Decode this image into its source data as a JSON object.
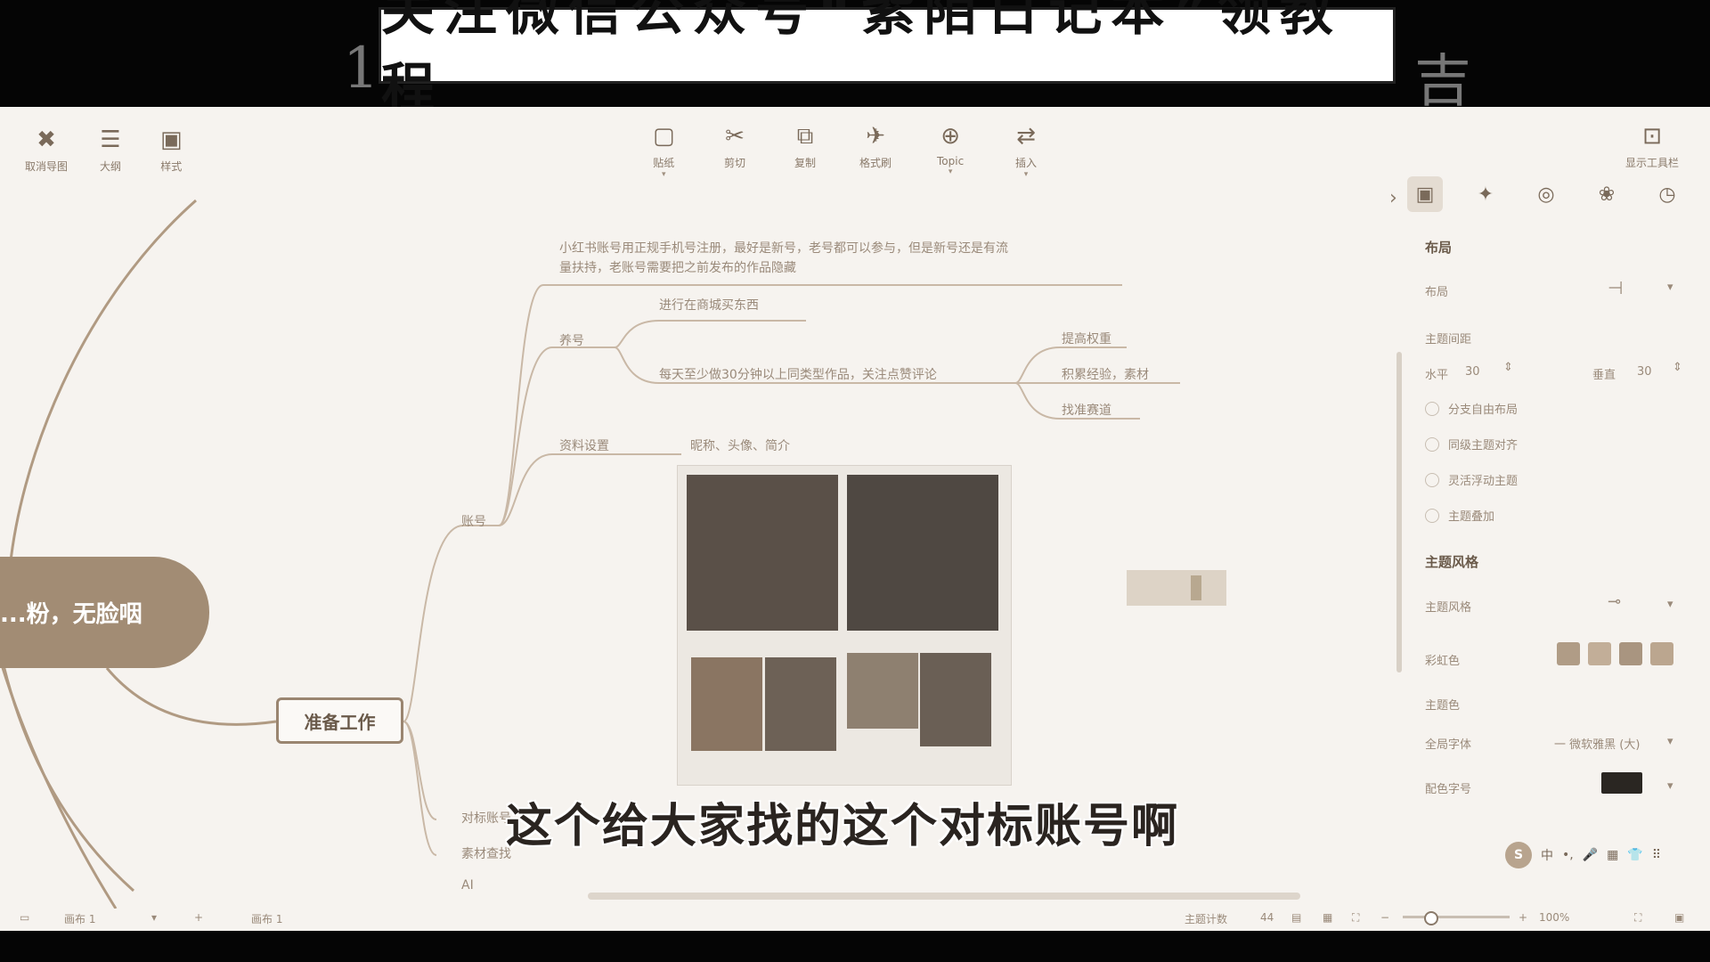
{
  "banner": {
    "text": "关注微信公众号“紫陌日记本”领教程",
    "left_glyph": "1",
    "right_glyph": "吉"
  },
  "toolbar_left": [
    {
      "icon": "✖",
      "label": "取消导图"
    },
    {
      "icon": "☰",
      "label": "大纲"
    },
    {
      "icon": "▣",
      "label": "样式"
    }
  ],
  "toolbar_center": [
    {
      "icon": "▢",
      "label": "贴纸",
      "caret": "▾"
    },
    {
      "icon": "✂",
      "label": "剪切",
      "caret": ""
    },
    {
      "icon": "⧉",
      "label": "复制",
      "caret": ""
    },
    {
      "icon": "✈",
      "label": "格式刷",
      "caret": ""
    },
    {
      "icon": "⊕",
      "label": "Topic",
      "caret": "▾"
    },
    {
      "icon": "⇄",
      "label": "插入",
      "caret": "▾"
    }
  ],
  "toolbar_right": {
    "icon": "⊡",
    "label": "显示工具栏"
  },
  "mindmap": {
    "central": "...粉，无脸咽",
    "prep_node": "准备工作",
    "note_long_1": "小红书账号用正规手机号注册，最好是新号，老号都可以参与，但是新号还是有流",
    "note_long_2": "量扶持，老账号需要把之前发布的作品隐藏",
    "yanghao": "养号",
    "yanghao_sub1": "进行在商城买东西",
    "yanghao_sub2": "每天至少做30分钟以上同类型作品，关注点赞评论",
    "right_1": "提高权重",
    "right_2": "积累经验，素材",
    "right_3": "找准赛道",
    "ziliao": "资料设置",
    "ziliao_sub": "昵称、头像、简介",
    "zhanghao": "账号",
    "branch_a": "对标账号",
    "branch_b": "素材查找",
    "branch_c": "AI"
  },
  "subtitle": "这个给大家找的这个对标账号啊",
  "panel": {
    "tabs": [
      "▣",
      "✦",
      "◎",
      "❀",
      "◷"
    ],
    "layout_title": "布局",
    "structure_label": "布局",
    "structure_value": "⊣",
    "spacing_title": "主题间距",
    "horizontal_label": "水平",
    "horizontal_value": "30",
    "vertical_label": "垂直",
    "vertical_value": "30",
    "options": [
      "分支自由布局",
      "同级主题对齐",
      "灵活浮动主题",
      "主题叠加"
    ],
    "style_title": "主题风格",
    "style_label": "主题风格",
    "color_label": "彩虹色",
    "theme_color_label": "主题色",
    "font_label": "全局字体",
    "font_value": "一 微软雅黑 (大)",
    "font_size_label": "配色字号"
  },
  "status": {
    "page": "画布 1",
    "sheet": "画布 1",
    "topics": "主题计数",
    "count": "44",
    "zoom": "100%"
  },
  "ime": {
    "logo": "S",
    "items": [
      "中",
      "•,",
      "🎤",
      "▦",
      "👕",
      "⠿"
    ]
  }
}
